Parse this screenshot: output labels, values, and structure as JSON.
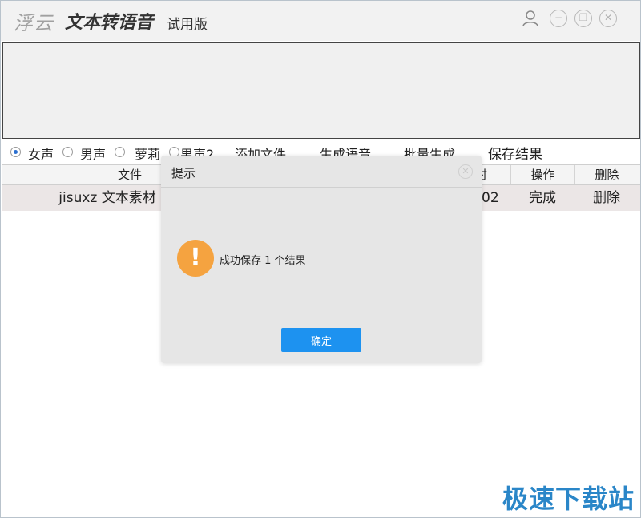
{
  "titlebar": {
    "brand": "浮云",
    "app_name": "文本转语音",
    "edition": "试用版",
    "icons": [
      "user-icon",
      "minimize-icon",
      "maximize-icon",
      "close-icon"
    ],
    "min_glyph": "−",
    "max_glyph": "❐",
    "close_glyph": "✕"
  },
  "text_input": {
    "value": ""
  },
  "options": {
    "voices": [
      {
        "label": "女声",
        "selected": true
      },
      {
        "label": "男声",
        "selected": false
      },
      {
        "label": "萝莉",
        "selected": false
      },
      {
        "label": "男声2",
        "selected": false
      }
    ],
    "actions": {
      "add_file": "添加文件",
      "generate_speech": "生成语音",
      "batch_generate": "批量生成",
      "save_results": "保存结果"
    }
  },
  "table": {
    "headers": {
      "file": "文件",
      "time": "时",
      "operation": "操作",
      "delete": "删除"
    },
    "rows": [
      {
        "file": "jisuxz 文本素材",
        "time": "02",
        "operation": "完成",
        "delete": "删除"
      }
    ]
  },
  "dialog": {
    "title": "提示",
    "close_glyph": "✕",
    "icon": "warning-icon",
    "icon_glyph": "!",
    "message": "成功保存 1 个结果",
    "ok_label": "确定"
  },
  "watermark": "极速下载站",
  "colors": {
    "accent": "#1d92f0",
    "warning": "#f5a340",
    "watermark": "#2a86c8"
  }
}
